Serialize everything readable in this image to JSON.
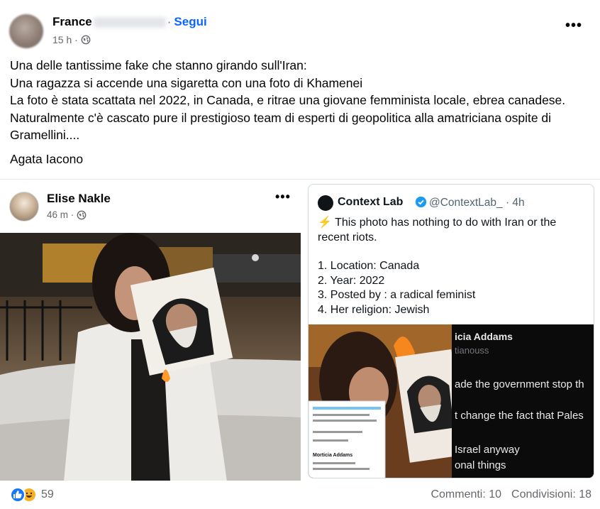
{
  "post": {
    "author_name": "France",
    "follow_label": "Segui",
    "separator": "·",
    "time": "15 h ·",
    "more_label": "•••",
    "lines": [
      "Una delle tantissime fake che stanno girando sull'Iran:",
      "Una ragazza si accende una sigaretta con una foto di Khamenei",
      "La foto è stata scattata nel 2022, in Canada, e ritrae una giovane femminista locale, ebrea canadese.",
      "Naturalmente c'è cascato pure il prestigioso team di esperti di geopolitica alla amatriciana ospite di Gramellini...."
    ],
    "signature": "Agata Iacono"
  },
  "embedded_post": {
    "name": "Elise Nakle",
    "time": "46 m ·",
    "more_label": "•••"
  },
  "tweet": {
    "name": "Context Lab",
    "handle": "@ContextLab_ · 4h",
    "intro_emoji": "⚡",
    "intro": "This photo has nothing to do with Iran or the recent riots.",
    "list": [
      "1. Location:  Canada",
      "2. Year:  2022",
      "3. Posted by :  a radical feminist",
      "4. Her religion:  Jewish"
    ],
    "inner_screenshot": {
      "name_fragment": "icia Addams",
      "handle_fragment": "tianouss",
      "lines": [
        "ade the government stop th",
        "t change the fact that Pales",
        "Israel anyway",
        "onal things"
      ],
      "mini_card_title": "Morticia Addams"
    }
  },
  "footer": {
    "reaction_count": "59",
    "comments": "Commenti: 10",
    "shares": "Condivisioni: 18"
  },
  "colors": {
    "link_blue": "#0866ff",
    "secondary_text": "#65676b",
    "like_blue": "#1877f2",
    "haha_yellow": "#f7b125"
  }
}
